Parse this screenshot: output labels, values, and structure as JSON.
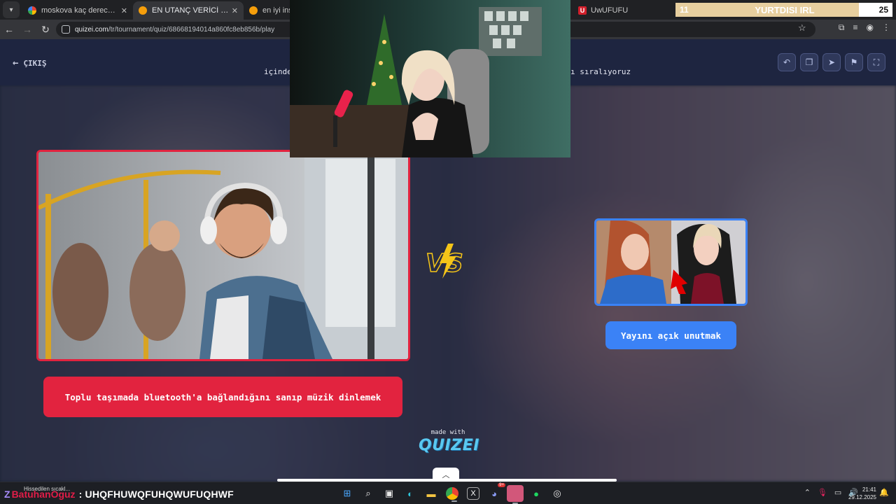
{
  "browser": {
    "tabs": [
      {
        "title": "moskova kaç derece - Google'da",
        "favicon_color": "#4285f4"
      },
      {
        "title": "EN UTANÇ VERİCİ DURUMLAR",
        "favicon_color": "#f59e0b"
      },
      {
        "title": "en iyi insta me",
        "favicon_color": "#f59e0b"
      }
    ],
    "far_tab": {
      "title": "UwUFUFU",
      "favicon_letter": "U"
    },
    "url_host": "quizei.com",
    "url_path": "/tr/tournament/quiz/68668194014a860fc8eb856b/play"
  },
  "overlay_widget": {
    "left": "11",
    "center": "YURTDISI IRL",
    "right": "25"
  },
  "quiz": {
    "exit_label": "ÇIKIŞ",
    "title_left": "içinde",
    "title_right": "ı sıralıyoruz",
    "left_option": {
      "label": "Toplu taşımada bluetooth'a bağlandığını sanıp müzik dinlemek",
      "accent": "#e2233f"
    },
    "right_option": {
      "label": "Yayını açık unutmak",
      "accent": "#3b82f6"
    },
    "made_with": "made with",
    "brand": "QUIZEI"
  },
  "taskbar": {
    "weather_text": "Hissedilen sıcakl...",
    "stream_user": "BatuhanOguz",
    "stream_message": ": UHQFHUWQFUHQWUFUQHWF",
    "time": "21:41",
    "date": "29.12.2025",
    "discord_badge": "9+"
  }
}
